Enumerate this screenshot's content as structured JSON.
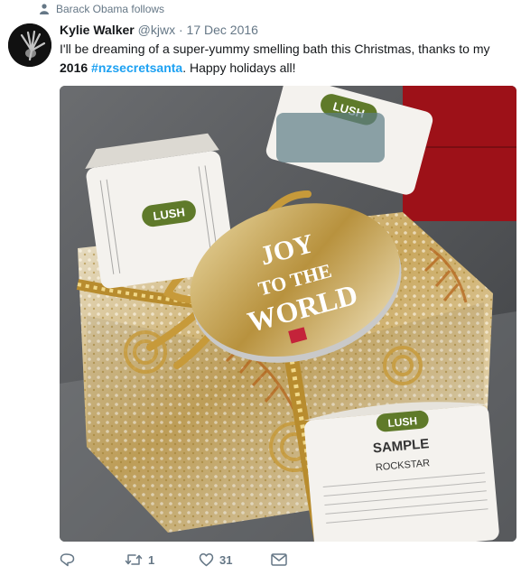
{
  "social_context": {
    "text": "Barack Obama follows",
    "icon": "person-icon"
  },
  "author": {
    "name": "Kylie Walker",
    "handle": "@kjwx",
    "separator": "·",
    "date": "17 Dec 2016"
  },
  "tweet": {
    "line1": "I'll be dreaming of a super-yummy smelling bath this Christmas, thanks to my",
    "year": "2016",
    "hashtag": "#nzsecretsanta",
    "after": ". Happy holidays all!"
  },
  "media": {
    "label_top": "LUSH",
    "tag_text_line1": "JOY",
    "tag_text_line2": "TO THE",
    "tag_text_line3": "WORLD",
    "sample_brand": "LUSH",
    "sample_word": "SAMPLE",
    "sample_product": "ROCKSTAR"
  },
  "actions": {
    "reply": {
      "icon": "reply-icon",
      "count": ""
    },
    "retweet": {
      "icon": "retweet-icon",
      "count": "1"
    },
    "like": {
      "icon": "heart-icon",
      "count": "31"
    },
    "message": {
      "icon": "envelope-icon",
      "count": ""
    }
  },
  "colors": {
    "accent": "#1da1f2",
    "muted": "#657786",
    "text": "#14171a"
  }
}
